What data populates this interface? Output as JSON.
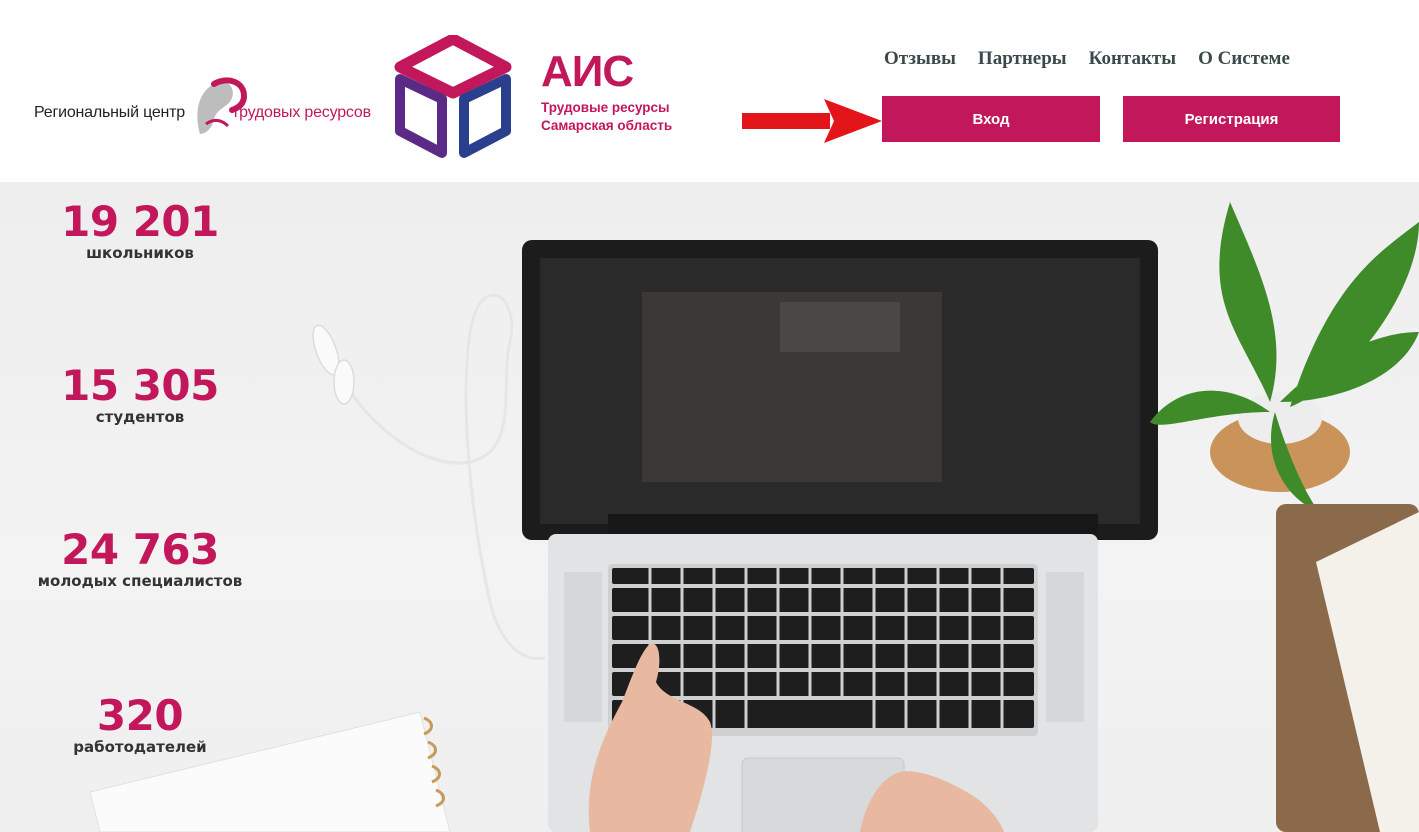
{
  "header": {
    "regional_center": {
      "text_left": "Региональный центр",
      "text_right": "трудовых ресурсов"
    },
    "ais": {
      "title": "АИС",
      "subtitle_line1": "Трудовые ресурсы",
      "subtitle_line2": "Самарская область"
    },
    "nav": [
      {
        "label": "Отзывы"
      },
      {
        "label": "Партнеры"
      },
      {
        "label": "Контакты"
      },
      {
        "label": "О Системе"
      }
    ],
    "login_label": "Вход",
    "register_label": "Регистрация"
  },
  "stats": [
    {
      "value": "19 201",
      "label": "школьников"
    },
    {
      "value": "15 305",
      "label": "студентов"
    },
    {
      "value": "24 763",
      "label": "молодых специалистов"
    },
    {
      "value": "320",
      "label": "работодателей"
    }
  ],
  "colors": {
    "brand": "#c2185b",
    "nav_text": "#3a4a4a",
    "arrow": "#e3151a"
  }
}
